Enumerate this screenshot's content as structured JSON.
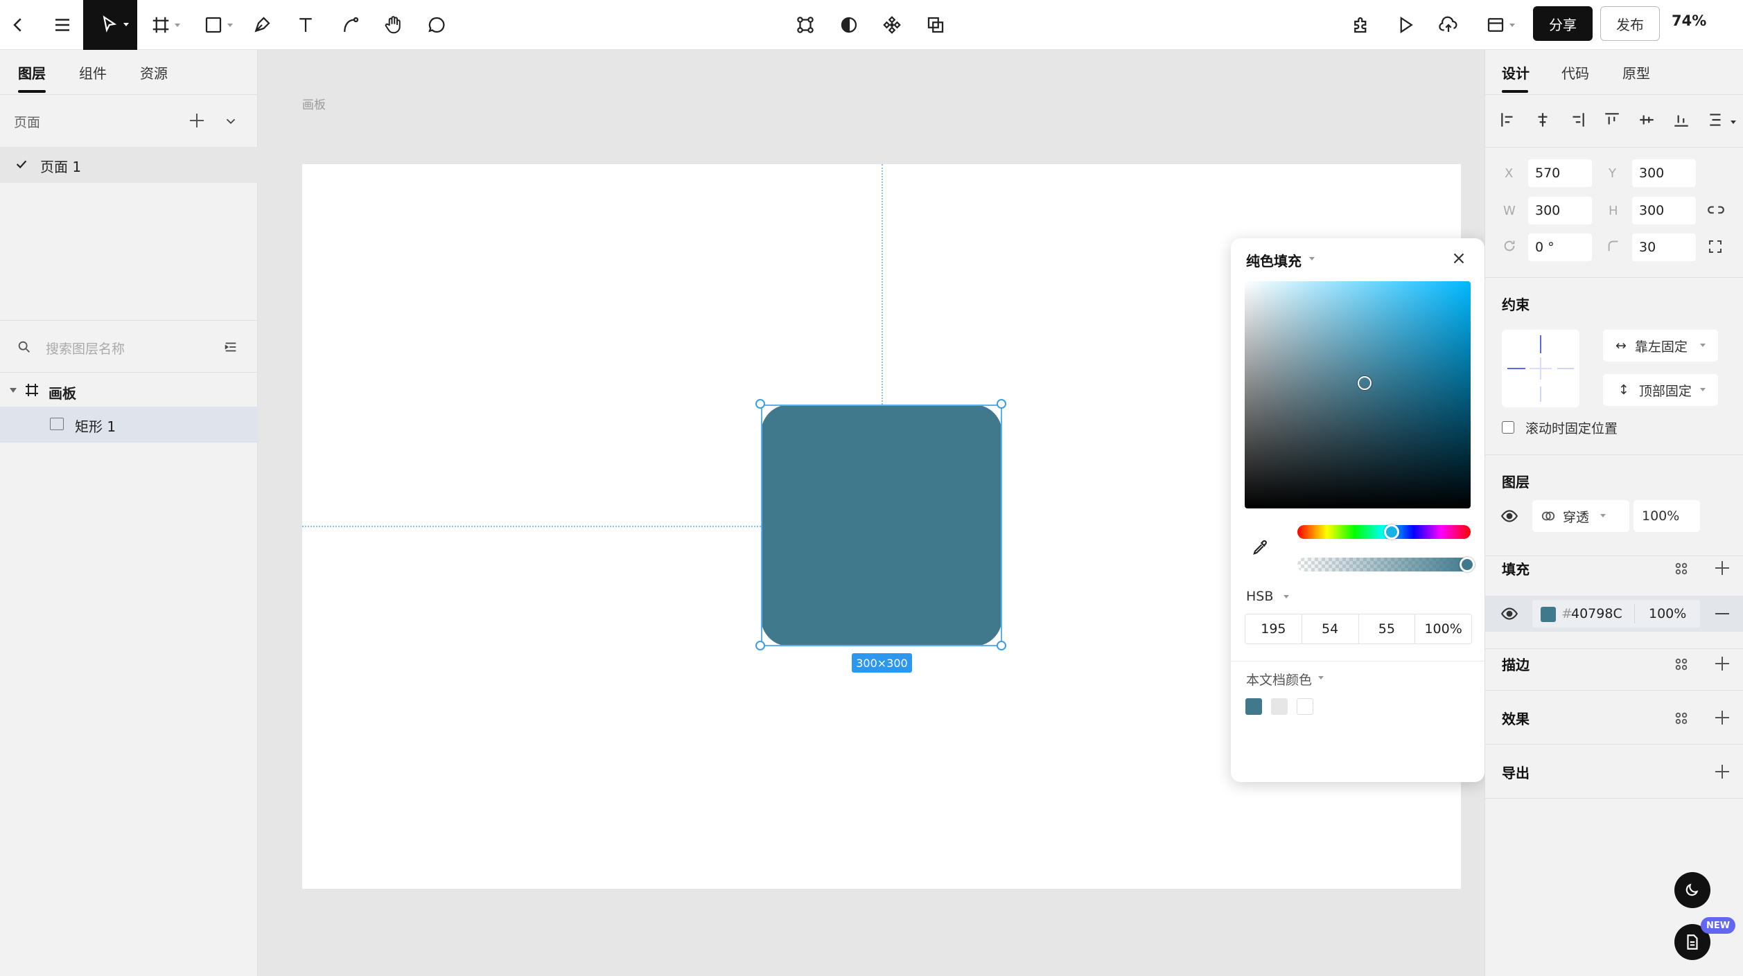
{
  "toolbar": {
    "share_label": "分享",
    "publish_label": "发布",
    "zoom": "74%"
  },
  "left_panel": {
    "tabs": [
      {
        "label": "图层",
        "active": true
      },
      {
        "label": "组件",
        "active": false
      },
      {
        "label": "资源",
        "active": false
      }
    ],
    "pages_title": "页面",
    "pages": [
      {
        "label": "页面 1",
        "selected": true
      }
    ],
    "search_placeholder": "搜索图层名称",
    "layers": [
      {
        "label": "画板",
        "type": "frame",
        "expanded": true
      },
      {
        "label": "矩形 1",
        "type": "rectangle",
        "selected": true
      }
    ]
  },
  "canvas": {
    "artboard_label": "画板",
    "size_badge": "300×300",
    "shape_color": "#40798C"
  },
  "color_popup": {
    "title": "纯色填充",
    "mode": "HSB",
    "values": [
      "195",
      "54",
      "55",
      "100%"
    ],
    "doc_colors_label": "本文档颜色",
    "doc_colors": [
      "#40798C",
      "#E6E6E6",
      "#FFFFFF"
    ]
  },
  "right_panel": {
    "tabs": [
      {
        "label": "设计",
        "active": true
      },
      {
        "label": "代码",
        "active": false
      },
      {
        "label": "原型",
        "active": false
      }
    ],
    "props": {
      "x_label": "X",
      "x": "570",
      "y_label": "Y",
      "y": "300",
      "w_label": "W",
      "w": "300",
      "h_label": "H",
      "h": "300",
      "rotation": "0 °",
      "radius": "30"
    },
    "constraints_title": "约束",
    "constraint_h": "靠左固定",
    "constraint_v": "顶部固定",
    "fix_on_scroll": "滚动时固定位置",
    "layer_title": "图层",
    "blend_mode": "穿透",
    "layer_opacity": "100%",
    "fill_title": "填充",
    "fill_hex": "40798C",
    "fill_opacity": "100%",
    "stroke_title": "描边",
    "effects_title": "效果",
    "export_title": "导出"
  },
  "floating": {
    "new_badge": "NEW"
  }
}
